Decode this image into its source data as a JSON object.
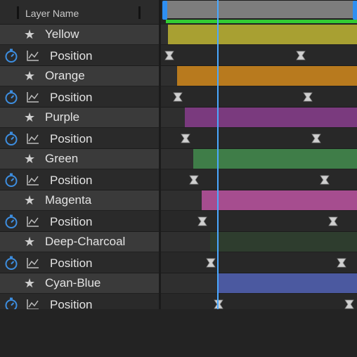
{
  "header": {
    "column_label": "Layer Name"
  },
  "layers": [
    {
      "name": "Yellow",
      "property": "Position",
      "color": "#a8a032"
    },
    {
      "name": "Orange",
      "property": "Position",
      "color": "#b87a1e"
    },
    {
      "name": "Purple",
      "property": "Position",
      "color": "#7a3a7e"
    },
    {
      "name": "Green",
      "property": "Position",
      "color": "#3f7d48"
    },
    {
      "name": "Magenta",
      "property": "Position",
      "color": "#a64d8f"
    },
    {
      "name": "Deep-Charcoal",
      "property": "Position",
      "color": "#2e3d2e"
    },
    {
      "name": "Cyan-Blue",
      "property": "Position",
      "color": "#4b59a0"
    }
  ],
  "colors": {
    "work_area": "#7d7d7d",
    "work_area_handles": "#2e8ff2",
    "render_strip": "#33cc33",
    "playhead": "#4aa8ff",
    "stopwatch": "#3d8ee0"
  }
}
